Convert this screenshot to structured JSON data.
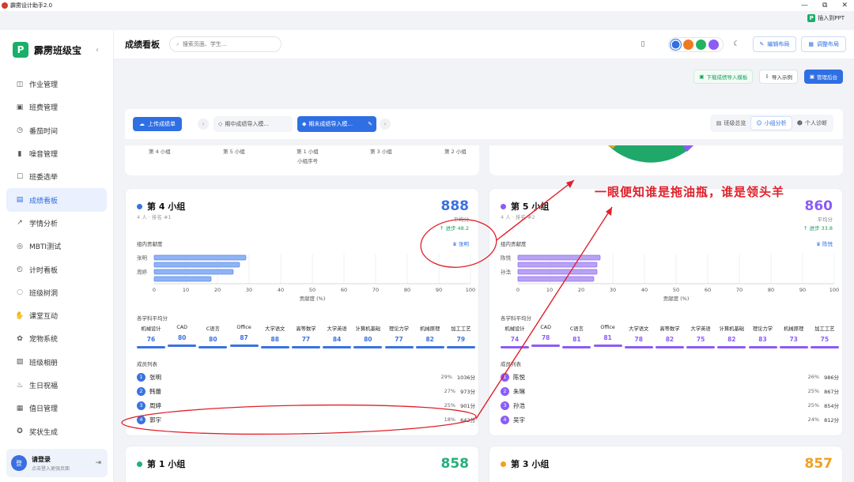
{
  "window": {
    "title": "霹雳设计助手2.0",
    "insert_ppt": "插入到PPT",
    "ppt_logo": "P"
  },
  "brand": {
    "name": "霹雳班级宝",
    "logo": "P",
    "collapse": "‹"
  },
  "sidebar": {
    "items": [
      {
        "label": "作业管理",
        "icon": "book-icon",
        "glyph": "◫"
      },
      {
        "label": "班费管理",
        "icon": "wallet-icon",
        "glyph": "▣"
      },
      {
        "label": "番茄时间",
        "icon": "timer-icon",
        "glyph": "◷"
      },
      {
        "label": "噪音管理",
        "icon": "sound-icon",
        "glyph": "▮"
      },
      {
        "label": "班委选举",
        "icon": "vote-icon",
        "glyph": "☐"
      },
      {
        "label": "成绩看板",
        "icon": "board-icon",
        "glyph": "▤",
        "active": true
      },
      {
        "label": "学情分析",
        "icon": "trend-icon",
        "glyph": "↗"
      },
      {
        "label": "MBTI测试",
        "icon": "pin-icon",
        "glyph": "◎"
      },
      {
        "label": "计时看板",
        "icon": "clock-icon",
        "glyph": "◴"
      },
      {
        "label": "班级树洞",
        "icon": "chat-icon",
        "glyph": "◌"
      },
      {
        "label": "课堂互动",
        "icon": "hand-icon",
        "glyph": "✋"
      },
      {
        "label": "宠物系统",
        "icon": "pet-icon",
        "glyph": "✿"
      },
      {
        "label": "班级相册",
        "icon": "photo-icon",
        "glyph": "▨"
      },
      {
        "label": "生日祝福",
        "icon": "cake-icon",
        "glyph": "♨"
      },
      {
        "label": "值日管理",
        "icon": "calendar-icon",
        "glyph": "▦"
      },
      {
        "label": "奖状生成",
        "icon": "award-icon",
        "glyph": "✪"
      }
    ],
    "login": {
      "title": "请登录",
      "subtitle": "点击登入更强页面",
      "avatar": "登",
      "exit": "⇥"
    }
  },
  "topbar": {
    "page_title": "成绩看板",
    "search_placeholder": "搜索页面、学生...",
    "theme_colors": [
      "#2f6fe4",
      "#f07a22",
      "#22b35e",
      "#8b5cf6"
    ],
    "edit_layout": "编辑布局",
    "adjust_layout": "调整布局"
  },
  "actions": {
    "download_template": "下载成绩导入模板",
    "import_example": "导入示例",
    "manage": "管理后台"
  },
  "toolbar": {
    "upload": "上传成绩单",
    "tabs": [
      "期中成绩导入模...",
      "期末成绩导入模..."
    ],
    "views": [
      "班级总览",
      "小组分析",
      "个人诊断"
    ]
  },
  "overview": {
    "groups": [
      "第 4 小组",
      "第 5 小组",
      "第 1 小组",
      "第 3 小组",
      "第 2 小组"
    ],
    "axis_label": "小组序号"
  },
  "cards": [
    {
      "name": "第 4 小组",
      "meta": "4 人 · 排名 #1",
      "score": "888",
      "progress": "↑ 进步 48.2",
      "score_sub": "平均分",
      "color": "#3a72e0",
      "bar_fill": "#8fb3f5",
      "bar_stroke": "#5a8be8",
      "contrib_title": "组内贡献度",
      "badge": "♛ 张明",
      "chart_data": {
        "type": "bar",
        "orientation": "horizontal",
        "categories": [
          "张明",
          "韩蕾",
          "周婷",
          "郭宇"
        ],
        "values": [
          29,
          27,
          25,
          18
        ],
        "xlim": [
          0,
          100
        ],
        "xticks": [
          0,
          10,
          20,
          30,
          40,
          50,
          60,
          70,
          80,
          90,
          100
        ],
        "visible_labels": [
          "张明",
          "",
          "周婷",
          ""
        ],
        "xlabel": "贡献度 (%)"
      },
      "subjects_title": "各学科平均分",
      "subjects": [
        {
          "name": "机械设计",
          "value": "76"
        },
        {
          "name": "CAD",
          "value": "80"
        },
        {
          "name": "C语言",
          "value": "80"
        },
        {
          "name": "Office",
          "value": "87"
        },
        {
          "name": "大学语文",
          "value": "88"
        },
        {
          "name": "高等数学",
          "value": "77"
        },
        {
          "name": "大学英语",
          "value": "84"
        },
        {
          "name": "计算机基础",
          "value": "80"
        },
        {
          "name": "理论力学",
          "value": "77"
        },
        {
          "name": "机械原理",
          "value": "82"
        },
        {
          "name": "加工工艺",
          "value": "79"
        }
      ],
      "members_title": "成员列表",
      "members": [
        {
          "idx": "1",
          "name": "张明",
          "pct": "29%",
          "score": "1036分"
        },
        {
          "idx": "2",
          "name": "韩蕾",
          "pct": "27%",
          "score": "973分"
        },
        {
          "idx": "3",
          "name": "周婷",
          "pct": "25%",
          "score": "901分"
        },
        {
          "idx": "4",
          "name": "郭宇",
          "pct": "18%",
          "score": "642分"
        }
      ]
    },
    {
      "name": "第 5 小组",
      "meta": "4 人 · 排名 #2",
      "score": "860",
      "progress": "↑ 进步 33.8",
      "score_sub": "平均分",
      "color": "#8b5cf6",
      "bar_fill": "#b9a1f5",
      "bar_stroke": "#8e6ef0",
      "contrib_title": "组内贡献度",
      "badge": "♛ 陈悦",
      "chart_data": {
        "type": "bar",
        "orientation": "horizontal",
        "categories": [
          "陈悦",
          "朱琳",
          "孙浩",
          "吴宇"
        ],
        "values": [
          26,
          25,
          25,
          24
        ],
        "xlim": [
          0,
          100
        ],
        "xticks": [
          0,
          10,
          20,
          30,
          40,
          50,
          60,
          70,
          80,
          90,
          100
        ],
        "visible_labels": [
          "陈悦",
          "",
          "孙浩",
          ""
        ],
        "xlabel": "贡献度 (%)"
      },
      "subjects_title": "各学科平均分",
      "subjects": [
        {
          "name": "机械设计",
          "value": "74"
        },
        {
          "name": "CAD",
          "value": "78"
        },
        {
          "name": "C语言",
          "value": "81"
        },
        {
          "name": "Office",
          "value": "81"
        },
        {
          "name": "大学语文",
          "value": "78"
        },
        {
          "name": "高等数学",
          "value": "82"
        },
        {
          "name": "大学英语",
          "value": "75"
        },
        {
          "name": "计算机基础",
          "value": "82"
        },
        {
          "name": "理论力学",
          "value": "83"
        },
        {
          "name": "机械原理",
          "value": "73"
        },
        {
          "name": "加工工艺",
          "value": "75"
        }
      ],
      "members_title": "成员列表",
      "members": [
        {
          "idx": "1",
          "name": "陈悦",
          "pct": "26%",
          "score": "986分"
        },
        {
          "idx": "2",
          "name": "朱琳",
          "pct": "25%",
          "score": "867分"
        },
        {
          "idx": "3",
          "name": "孙浩",
          "pct": "25%",
          "score": "854分"
        },
        {
          "idx": "4",
          "name": "吴宇",
          "pct": "24%",
          "score": "812分"
        }
      ]
    }
  ],
  "bottom_cards": [
    {
      "name": "第 1 小组",
      "score": "858",
      "color": "#22b07a"
    },
    {
      "name": "第 3 小组",
      "score": "857",
      "color": "#f0a020"
    }
  ],
  "annotation": {
    "caption": "一眼便知谁是拖油瓶，谁是领头羊",
    "color": "#e0202a"
  }
}
